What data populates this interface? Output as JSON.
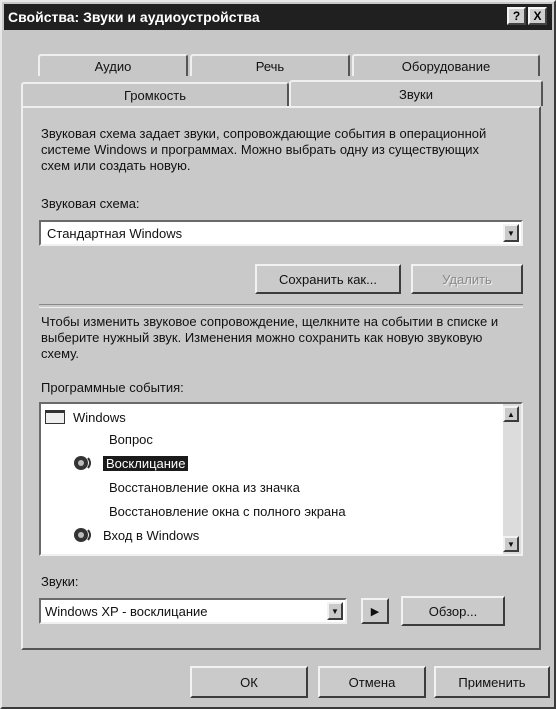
{
  "window": {
    "title": "Свойства: Звуки и аудиоустройства",
    "help_button": "?",
    "close_button": "X"
  },
  "tabs": {
    "row_back": [
      "Аудио",
      "Речь",
      "Оборудование"
    ],
    "row_front": [
      "Громкость",
      "Звуки"
    ],
    "active": "Звуки"
  },
  "sounds_tab": {
    "intro_text": "Звуковая схема задает звуки, сопровождающие события в операционной системе Windows и программах. Можно выбрать одну из существующих схем или создать новую.",
    "scheme_label": "Звуковая схема:",
    "scheme_value": "Стандартная Windows",
    "save_as_button": "Сохранить как...",
    "delete_button": "Удалить",
    "events_help_text": "Чтобы изменить звуковое сопровождение, щелкните на событии в списке и выберите нужный звук. Изменения можно сохранить как новую звуковую схему.",
    "events_label": "Программные события:",
    "events": [
      {
        "label": "Windows",
        "icon": "folder-icon",
        "selected": false,
        "indent": 0
      },
      {
        "label": "Вопрос",
        "icon": "",
        "selected": false,
        "indent": 1
      },
      {
        "label": "Восклицание",
        "icon": "speaker-icon",
        "selected": true,
        "indent": 1
      },
      {
        "label": "Восстановление окна из значка",
        "icon": "",
        "selected": false,
        "indent": 1
      },
      {
        "label": "Восстановление окна с полного экрана",
        "icon": "",
        "selected": false,
        "indent": 1
      },
      {
        "label": "Вход в Windows",
        "icon": "speaker-icon",
        "selected": false,
        "indent": 1
      }
    ],
    "sounds_label": "Звуки:",
    "sound_value": "Windows XP - восклицание",
    "play_button": "▶",
    "browse_button": "Обзор..."
  },
  "footer": {
    "ok_button": "ОК",
    "cancel_button": "Отмена",
    "apply_button": "Применить"
  }
}
